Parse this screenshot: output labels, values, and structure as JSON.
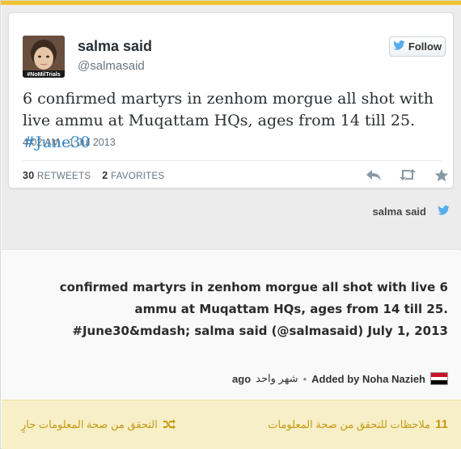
{
  "tweet": {
    "author_name": "salma said",
    "author_handle": "@salmasaid",
    "avatar_badge": "#NoMilTrials",
    "follow_label": "Follow",
    "text_main": "6 confirmed martyrs in zenhom morgue all shot with live ammu at Muqattam HQs, ages from 14 till 25.",
    "hashtag": "#June30",
    "timestamp": "4:02 AM - 1 Jul 2013",
    "retweets_count": "30",
    "retweets_label": "RETWEETS",
    "favorites_count": "2",
    "favorites_label": "FAVORITES",
    "icons": [
      "reply-icon",
      "retweet-icon",
      "favorite-icon",
      "twitter-bird-icon"
    ]
  },
  "embed_attribution": "salma said",
  "quote_lines": [
    "confirmed martyrs in zenhom morgue all shot with live 6",
    "ammu at Muqattam HQs, ages from 14 till 25.",
    "#June30&mdash; salma said (@salmasaid) July 1, 2013"
  ],
  "added": {
    "by_text": "Added by Noha Nazieh",
    "separator": "•",
    "time_text": "شهر واحد",
    "ago_text": "ago"
  },
  "footer": {
    "left_text": "التحقق من صحة المعلومات جارٍ",
    "right_count": "11",
    "right_text": "ملاحظات للتحقق من صحة المعلومات"
  },
  "colors": {
    "accent_yellow": "#f2c230",
    "twitter_blue": "#55acee",
    "hashtag_blue": "#2a8ad2",
    "footer_bg": "#f7efc7",
    "footer_text": "#c49a15"
  }
}
